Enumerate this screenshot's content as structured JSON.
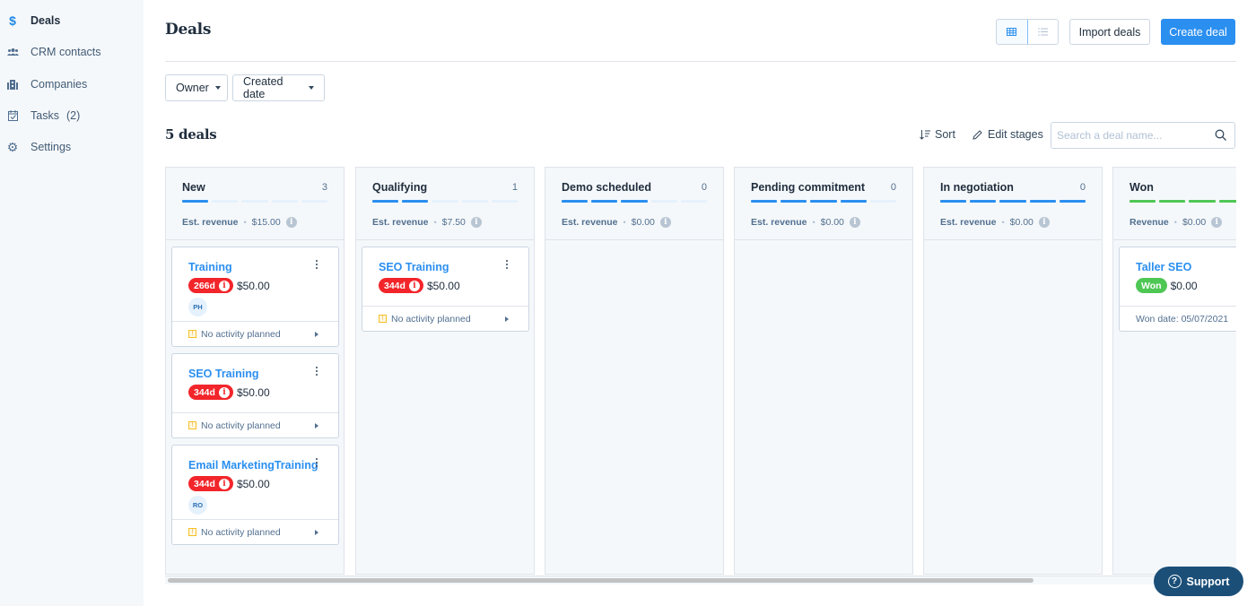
{
  "sidebar": {
    "items": [
      {
        "label": "Deals",
        "icon": "dollar-icon",
        "glyph": "$",
        "active": true
      },
      {
        "label": "CRM contacts",
        "icon": "contacts-icon",
        "glyph": ""
      },
      {
        "label": "Companies",
        "icon": "companies-icon",
        "glyph": ""
      },
      {
        "label": "Tasks",
        "count": "(2)",
        "icon": "tasks-icon",
        "glyph": ""
      },
      {
        "label": "Settings",
        "icon": "gear-icon",
        "glyph": "⚙"
      }
    ]
  },
  "header": {
    "title": "Deals",
    "import_label": "Import deals",
    "create_label": "Create deal",
    "view_modes": [
      "board",
      "list"
    ],
    "active_view": "board"
  },
  "filters": {
    "owner_label": "Owner",
    "created_label": "Created date"
  },
  "toolbar": {
    "deals_count": "5 deals",
    "sort_label": "Sort",
    "edit_stages_label": "Edit stages",
    "search_placeholder": "Search a deal name..."
  },
  "colors": {
    "accent": "#2b8ff0",
    "won": "#4fc755",
    "overdue": "#f2252a",
    "support": "#1b4f78"
  },
  "stages": [
    {
      "title": "New",
      "count": "3",
      "progress": 1,
      "segments": 5,
      "kind": "open",
      "revenue_label": "Est. revenue",
      "revenue": "$15.00",
      "deals": [
        {
          "name": "Training",
          "age": "266d",
          "amount": "$50.00",
          "owner": "PH",
          "footer": "No activity planned"
        },
        {
          "name": "SEO Training",
          "age": "344d",
          "amount": "$50.00",
          "owner": "",
          "footer": "No activity planned"
        },
        {
          "name": "Email MarketingTraining",
          "age": "344d",
          "amount": "$50.00",
          "owner": "RO",
          "footer": "No activity planned"
        }
      ]
    },
    {
      "title": "Qualifying",
      "count": "1",
      "progress": 2,
      "segments": 5,
      "kind": "open",
      "revenue_label": "Est. revenue",
      "revenue": "$7.50",
      "deals": [
        {
          "name": "SEO Training",
          "age": "344d",
          "amount": "$50.00",
          "owner": "",
          "footer": "No activity planned"
        }
      ]
    },
    {
      "title": "Demo scheduled",
      "count": "0",
      "progress": 3,
      "segments": 5,
      "kind": "open",
      "revenue_label": "Est. revenue",
      "revenue": "$0.00",
      "deals": []
    },
    {
      "title": "Pending commitment",
      "count": "0",
      "progress": 4,
      "segments": 5,
      "kind": "open",
      "revenue_label": "Est. revenue",
      "revenue": "$0.00",
      "deals": []
    },
    {
      "title": "In negotiation",
      "count": "0",
      "progress": 5,
      "segments": 5,
      "kind": "open",
      "revenue_label": "Est. revenue",
      "revenue": "$0.00",
      "deals": []
    },
    {
      "title": "Won",
      "count": "",
      "progress": 5,
      "segments": 5,
      "kind": "won",
      "revenue_label": "Revenue",
      "revenue": "$0.00",
      "deals": [
        {
          "name": "Taller SEO",
          "status": "Won",
          "amount": "$0.00",
          "owner": "",
          "footer": "Won date: 05/07/2021"
        }
      ]
    }
  ],
  "support": {
    "label": "Support"
  }
}
